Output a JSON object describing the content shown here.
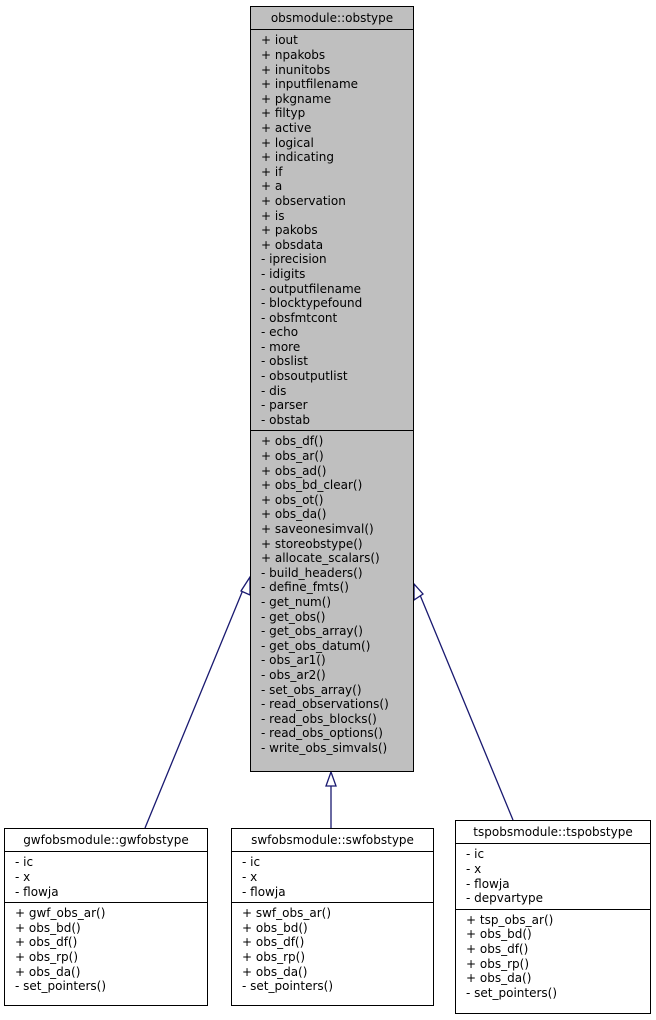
{
  "diagram": {
    "type": "inheritance",
    "edge_color": "#191970",
    "base_fill": "#bfbfbf"
  },
  "base": {
    "name": "obsmodule::obstype",
    "attributes": [
      "+ iout",
      "+ npakobs",
      "+ inunitobs",
      "+ inputfilename",
      "+ pkgname",
      "+ filtyp",
      "+ active",
      "+ logical",
      "+ indicating",
      "+ if",
      "+ a",
      "+ observation",
      "+ is",
      "+ pakobs",
      "+ obsdata",
      "- iprecision",
      "- idigits",
      "- outputfilename",
      "- blocktypefound",
      "- obsfmtcont",
      "- echo",
      "- more",
      "- obslist",
      "- obsoutputlist",
      "- dis",
      "- parser",
      "- obstab"
    ],
    "methods": [
      "+ obs_df()",
      "+ obs_ar()",
      "+ obs_ad()",
      "+ obs_bd_clear()",
      "+ obs_ot()",
      "+ obs_da()",
      "+ saveonesimval()",
      "+ storeobstype()",
      "+ allocate_scalars()",
      "- build_headers()",
      "- define_fmts()",
      "- get_num()",
      "- get_obs()",
      "- get_obs_array()",
      "- get_obs_datum()",
      "- obs_ar1()",
      "- obs_ar2()",
      "- set_obs_array()",
      "- read_observations()",
      "- read_obs_blocks()",
      "- read_obs_options()",
      "- write_obs_simvals()"
    ]
  },
  "derived": [
    {
      "name": "gwfobsmodule::gwfobstype",
      "attributes": [
        "- ic",
        "- x",
        "- flowja"
      ],
      "methods": [
        "+ gwf_obs_ar()",
        "+ obs_bd()",
        "+ obs_df()",
        "+ obs_rp()",
        "+ obs_da()",
        "- set_pointers()"
      ]
    },
    {
      "name": "swfobsmodule::swfobstype",
      "attributes": [
        "- ic",
        "- x",
        "- flowja"
      ],
      "methods": [
        "+ swf_obs_ar()",
        "+ obs_bd()",
        "+ obs_df()",
        "+ obs_rp()",
        "+ obs_da()",
        "- set_pointers()"
      ]
    },
    {
      "name": "tspobsmodule::tspobstype",
      "attributes": [
        "- ic",
        "- x",
        "- flowja",
        "- depvartype"
      ],
      "methods": [
        "+ tsp_obs_ar()",
        "+ obs_bd()",
        "+ obs_df()",
        "+ obs_rp()",
        "+ obs_da()",
        "- set_pointers()"
      ]
    }
  ]
}
